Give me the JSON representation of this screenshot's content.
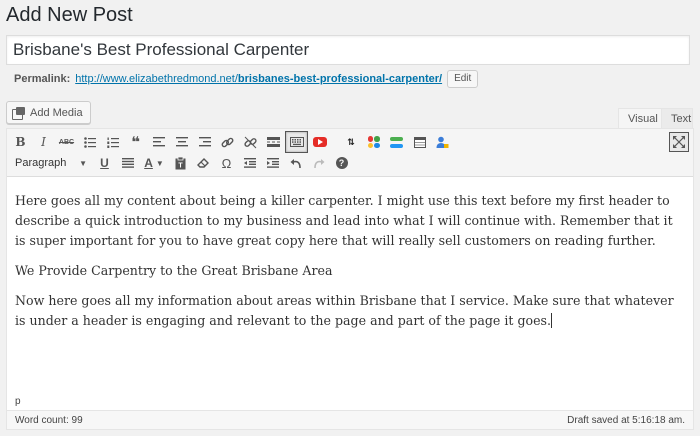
{
  "page": {
    "title": "Add New Post"
  },
  "post": {
    "title": "Brisbane's Best Professional Carpenter"
  },
  "permalink": {
    "label": "Permalink:",
    "base_url": "http://www.elizabethredmond.net/",
    "slug": "brisbanes-best-professional-carpenter/",
    "edit_label": "Edit"
  },
  "media": {
    "add_label": "Add Media"
  },
  "tabs": {
    "visual": "Visual",
    "text": "Text"
  },
  "toolbar": {
    "row1": [
      "bold",
      "italic",
      "strikethrough",
      "bulleted-list",
      "numbered-list",
      "blockquote",
      "align-left",
      "align-center",
      "align-right",
      "insert-link",
      "remove-link",
      "read-more",
      "toolbar-toggle",
      "youtube",
      "download",
      "color-grid",
      "color-bars",
      "tablepress",
      "user-lock"
    ],
    "row2": [
      "format-select",
      "underline",
      "justify",
      "text-color",
      "paste-as-text",
      "clear-formatting",
      "special-character",
      "outdent",
      "indent",
      "undo",
      "redo",
      "help"
    ],
    "format_value": "Paragraph",
    "glyphs": {
      "bold": "B",
      "italic": "I",
      "strikethrough": "ABC",
      "blockquote": "❝",
      "underline": "U",
      "text_color": "A",
      "special_character": "Ω",
      "help": "?"
    },
    "colors": {
      "youtube": "#e52d27",
      "grid": [
        "#e53935",
        "#43a047",
        "#fbc02d",
        "#1e88e5"
      ],
      "bars": [
        "#4caf50",
        "#2196f3"
      ]
    }
  },
  "content": {
    "paragraphs": [
      "Here goes all my content about being a killer carpenter. I might use this text before my first header to describe a quick introduction to my business and lead into what I will continue with. Remember that it is super important for you to have great copy here that will really sell customers on reading further.",
      "We Provide Carpentry to the Great Brisbane Area",
      "Now here goes all my information about areas within Brisbane that I service. Make sure that whatever is under a header is engaging and relevant to the page and part of the page it goes."
    ]
  },
  "status": {
    "path": "p",
    "word_count": "Word count: 99",
    "draft_saved": "Draft saved at 5:16:18 am."
  }
}
